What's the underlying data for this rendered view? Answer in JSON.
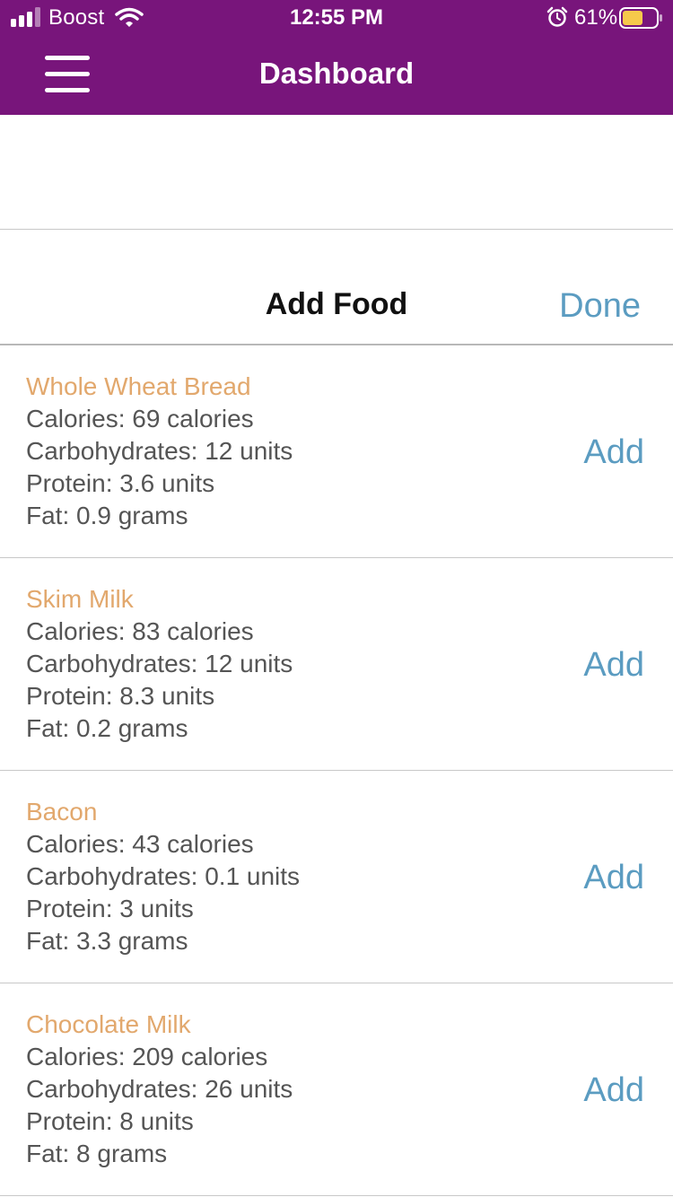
{
  "status_bar": {
    "carrier": "Boost",
    "time": "12:55 PM",
    "battery_percent": "61%",
    "battery_level": 0.61,
    "icons": [
      "signal-icon",
      "wifi-icon",
      "alarm-icon",
      "battery-icon"
    ]
  },
  "nav": {
    "title": "Dashboard",
    "menu_icon": "hamburger-menu-icon"
  },
  "add_food": {
    "title": "Add Food",
    "done_label": "Done"
  },
  "foods": [
    {
      "name": "Whole Wheat Bread",
      "calories": "Calories: 69 calories",
      "carbs": "Carbohydrates: 12 units",
      "protein": "Protein: 3.6 units",
      "fat": "Fat: 0.9 grams",
      "add_label": "Add"
    },
    {
      "name": "Skim Milk",
      "calories": "Calories: 83 calories",
      "carbs": "Carbohydrates: 12 units",
      "protein": "Protein: 8.3 units",
      "fat": "Fat: 0.2 grams",
      "add_label": "Add"
    },
    {
      "name": "Bacon",
      "calories": "Calories: 43 calories",
      "carbs": "Carbohydrates: 0.1 units",
      "protein": "Protein: 3 units",
      "fat": "Fat: 3.3 grams",
      "add_label": "Add"
    },
    {
      "name": "Chocolate Milk",
      "calories": "Calories: 209 calories",
      "carbs": "Carbohydrates: 26 units",
      "protein": "Protein: 8 units",
      "fat": "Fat: 8 grams",
      "add_label": "Add"
    }
  ],
  "colors": {
    "header_bg": "#78157b",
    "food_name": "#e2a86d",
    "accent": "#5b9cc1",
    "battery_fill": "#f6c94b"
  }
}
